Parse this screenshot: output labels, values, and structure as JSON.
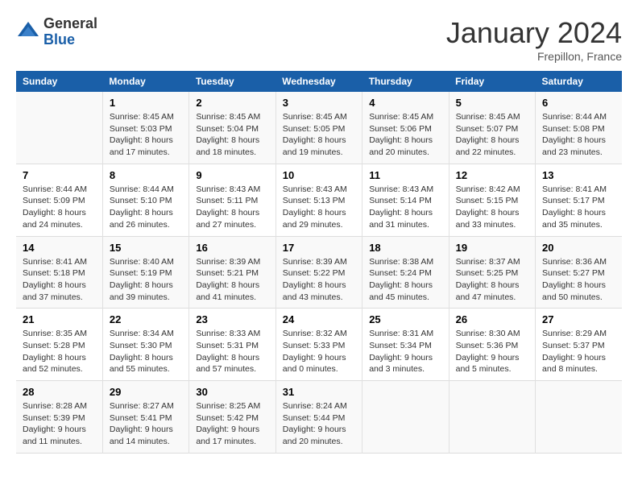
{
  "header": {
    "logo_general": "General",
    "logo_blue": "Blue",
    "month_title": "January 2024",
    "location": "Frepillon, France"
  },
  "columns": [
    "Sunday",
    "Monday",
    "Tuesday",
    "Wednesday",
    "Thursday",
    "Friday",
    "Saturday"
  ],
  "weeks": [
    [
      {
        "day": "",
        "sunrise": "",
        "sunset": "",
        "daylight": ""
      },
      {
        "day": "1",
        "sunrise": "Sunrise: 8:45 AM",
        "sunset": "Sunset: 5:03 PM",
        "daylight": "Daylight: 8 hours and 17 minutes."
      },
      {
        "day": "2",
        "sunrise": "Sunrise: 8:45 AM",
        "sunset": "Sunset: 5:04 PM",
        "daylight": "Daylight: 8 hours and 18 minutes."
      },
      {
        "day": "3",
        "sunrise": "Sunrise: 8:45 AM",
        "sunset": "Sunset: 5:05 PM",
        "daylight": "Daylight: 8 hours and 19 minutes."
      },
      {
        "day": "4",
        "sunrise": "Sunrise: 8:45 AM",
        "sunset": "Sunset: 5:06 PM",
        "daylight": "Daylight: 8 hours and 20 minutes."
      },
      {
        "day": "5",
        "sunrise": "Sunrise: 8:45 AM",
        "sunset": "Sunset: 5:07 PM",
        "daylight": "Daylight: 8 hours and 22 minutes."
      },
      {
        "day": "6",
        "sunrise": "Sunrise: 8:44 AM",
        "sunset": "Sunset: 5:08 PM",
        "daylight": "Daylight: 8 hours and 23 minutes."
      }
    ],
    [
      {
        "day": "7",
        "sunrise": "Sunrise: 8:44 AM",
        "sunset": "Sunset: 5:09 PM",
        "daylight": "Daylight: 8 hours and 24 minutes."
      },
      {
        "day": "8",
        "sunrise": "Sunrise: 8:44 AM",
        "sunset": "Sunset: 5:10 PM",
        "daylight": "Daylight: 8 hours and 26 minutes."
      },
      {
        "day": "9",
        "sunrise": "Sunrise: 8:43 AM",
        "sunset": "Sunset: 5:11 PM",
        "daylight": "Daylight: 8 hours and 27 minutes."
      },
      {
        "day": "10",
        "sunrise": "Sunrise: 8:43 AM",
        "sunset": "Sunset: 5:13 PM",
        "daylight": "Daylight: 8 hours and 29 minutes."
      },
      {
        "day": "11",
        "sunrise": "Sunrise: 8:43 AM",
        "sunset": "Sunset: 5:14 PM",
        "daylight": "Daylight: 8 hours and 31 minutes."
      },
      {
        "day": "12",
        "sunrise": "Sunrise: 8:42 AM",
        "sunset": "Sunset: 5:15 PM",
        "daylight": "Daylight: 8 hours and 33 minutes."
      },
      {
        "day": "13",
        "sunrise": "Sunrise: 8:41 AM",
        "sunset": "Sunset: 5:17 PM",
        "daylight": "Daylight: 8 hours and 35 minutes."
      }
    ],
    [
      {
        "day": "14",
        "sunrise": "Sunrise: 8:41 AM",
        "sunset": "Sunset: 5:18 PM",
        "daylight": "Daylight: 8 hours and 37 minutes."
      },
      {
        "day": "15",
        "sunrise": "Sunrise: 8:40 AM",
        "sunset": "Sunset: 5:19 PM",
        "daylight": "Daylight: 8 hours and 39 minutes."
      },
      {
        "day": "16",
        "sunrise": "Sunrise: 8:39 AM",
        "sunset": "Sunset: 5:21 PM",
        "daylight": "Daylight: 8 hours and 41 minutes."
      },
      {
        "day": "17",
        "sunrise": "Sunrise: 8:39 AM",
        "sunset": "Sunset: 5:22 PM",
        "daylight": "Daylight: 8 hours and 43 minutes."
      },
      {
        "day": "18",
        "sunrise": "Sunrise: 8:38 AM",
        "sunset": "Sunset: 5:24 PM",
        "daylight": "Daylight: 8 hours and 45 minutes."
      },
      {
        "day": "19",
        "sunrise": "Sunrise: 8:37 AM",
        "sunset": "Sunset: 5:25 PM",
        "daylight": "Daylight: 8 hours and 47 minutes."
      },
      {
        "day": "20",
        "sunrise": "Sunrise: 8:36 AM",
        "sunset": "Sunset: 5:27 PM",
        "daylight": "Daylight: 8 hours and 50 minutes."
      }
    ],
    [
      {
        "day": "21",
        "sunrise": "Sunrise: 8:35 AM",
        "sunset": "Sunset: 5:28 PM",
        "daylight": "Daylight: 8 hours and 52 minutes."
      },
      {
        "day": "22",
        "sunrise": "Sunrise: 8:34 AM",
        "sunset": "Sunset: 5:30 PM",
        "daylight": "Daylight: 8 hours and 55 minutes."
      },
      {
        "day": "23",
        "sunrise": "Sunrise: 8:33 AM",
        "sunset": "Sunset: 5:31 PM",
        "daylight": "Daylight: 8 hours and 57 minutes."
      },
      {
        "day": "24",
        "sunrise": "Sunrise: 8:32 AM",
        "sunset": "Sunset: 5:33 PM",
        "daylight": "Daylight: 9 hours and 0 minutes."
      },
      {
        "day": "25",
        "sunrise": "Sunrise: 8:31 AM",
        "sunset": "Sunset: 5:34 PM",
        "daylight": "Daylight: 9 hours and 3 minutes."
      },
      {
        "day": "26",
        "sunrise": "Sunrise: 8:30 AM",
        "sunset": "Sunset: 5:36 PM",
        "daylight": "Daylight: 9 hours and 5 minutes."
      },
      {
        "day": "27",
        "sunrise": "Sunrise: 8:29 AM",
        "sunset": "Sunset: 5:37 PM",
        "daylight": "Daylight: 9 hours and 8 minutes."
      }
    ],
    [
      {
        "day": "28",
        "sunrise": "Sunrise: 8:28 AM",
        "sunset": "Sunset: 5:39 PM",
        "daylight": "Daylight: 9 hours and 11 minutes."
      },
      {
        "day": "29",
        "sunrise": "Sunrise: 8:27 AM",
        "sunset": "Sunset: 5:41 PM",
        "daylight": "Daylight: 9 hours and 14 minutes."
      },
      {
        "day": "30",
        "sunrise": "Sunrise: 8:25 AM",
        "sunset": "Sunset: 5:42 PM",
        "daylight": "Daylight: 9 hours and 17 minutes."
      },
      {
        "day": "31",
        "sunrise": "Sunrise: 8:24 AM",
        "sunset": "Sunset: 5:44 PM",
        "daylight": "Daylight: 9 hours and 20 minutes."
      },
      {
        "day": "",
        "sunrise": "",
        "sunset": "",
        "daylight": ""
      },
      {
        "day": "",
        "sunrise": "",
        "sunset": "",
        "daylight": ""
      },
      {
        "day": "",
        "sunrise": "",
        "sunset": "",
        "daylight": ""
      }
    ]
  ]
}
